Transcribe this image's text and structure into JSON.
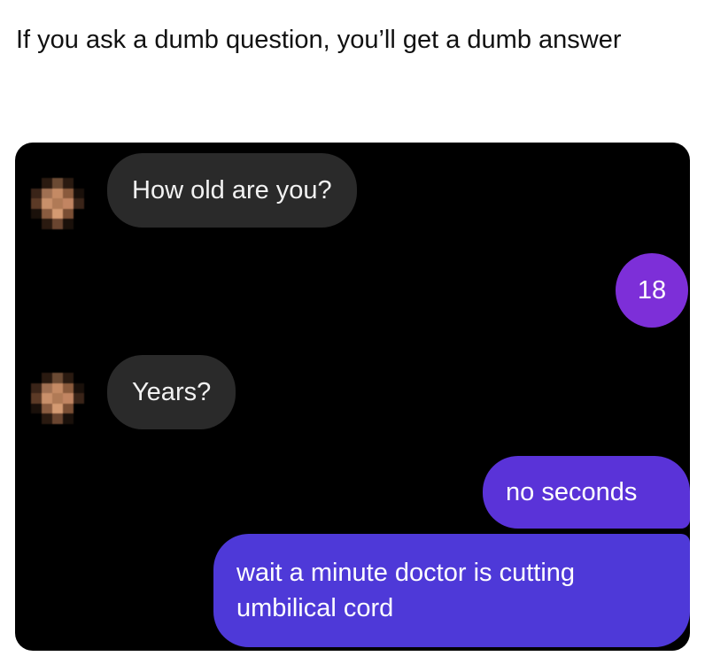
{
  "post": {
    "caption": "If you ask a dumb question, you’ll get a dumb answer"
  },
  "chat": {
    "messages": [
      {
        "from": "other",
        "text": "How old are you?"
      },
      {
        "from": "me",
        "text": "18"
      },
      {
        "from": "other",
        "text": "Years?"
      },
      {
        "from": "me",
        "text": "no seconds"
      },
      {
        "from": "me",
        "text": "wait a minute doctor is cutting umbilical cord"
      }
    ],
    "colors": {
      "background": "#000000",
      "incoming_bubble": "#2a2a2a",
      "outgoing_bubble": "#6b2fd6",
      "outgoing_bubble_blue": "#4e39d8"
    }
  }
}
